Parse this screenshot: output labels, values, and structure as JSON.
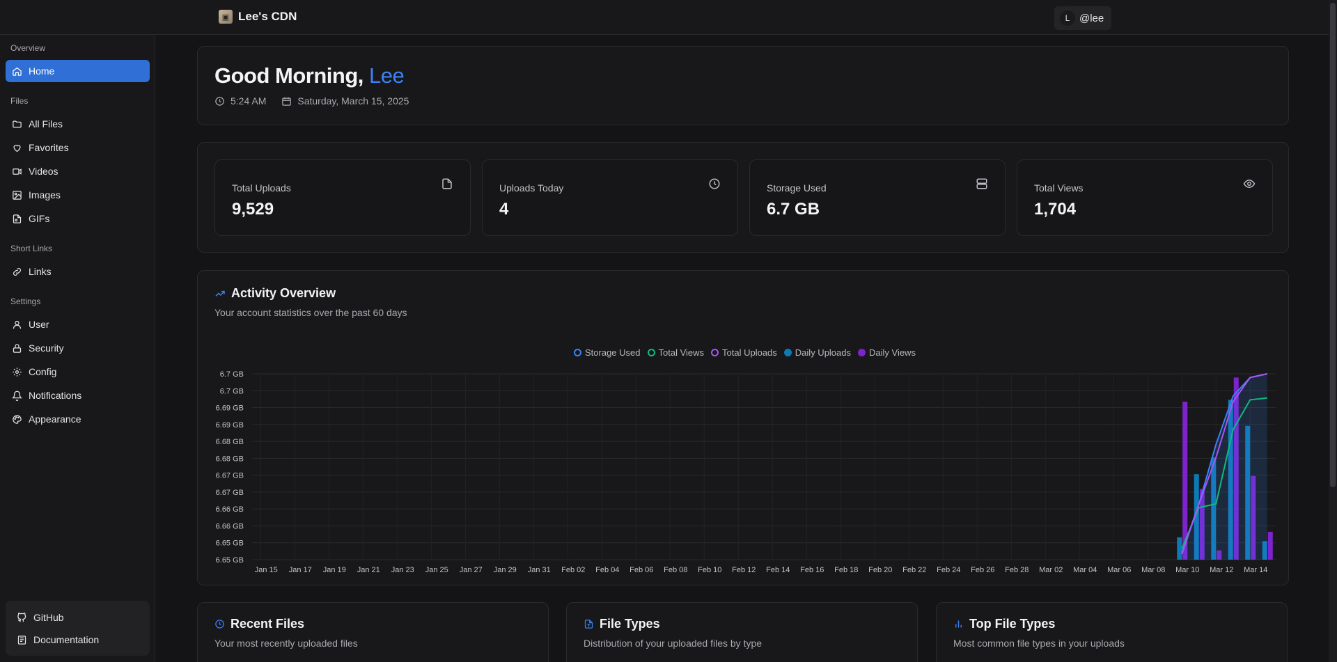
{
  "app": {
    "title": "Lee's CDN",
    "user_initial": "L",
    "username": "@lee"
  },
  "sidebar": {
    "sections": [
      {
        "title": "Overview",
        "items": [
          {
            "label": "Home",
            "icon": "home-icon",
            "active": true
          }
        ]
      },
      {
        "title": "Files",
        "items": [
          {
            "label": "All Files",
            "icon": "folder-icon"
          },
          {
            "label": "Favorites",
            "icon": "heart-icon"
          },
          {
            "label": "Videos",
            "icon": "video-icon"
          },
          {
            "label": "Images",
            "icon": "image-icon"
          },
          {
            "label": "GIFs",
            "icon": "file-gif-icon"
          }
        ]
      },
      {
        "title": "Short Links",
        "items": [
          {
            "label": "Links",
            "icon": "link-icon"
          }
        ]
      },
      {
        "title": "Settings",
        "items": [
          {
            "label": "User",
            "icon": "user-icon"
          },
          {
            "label": "Security",
            "icon": "lock-icon"
          },
          {
            "label": "Config",
            "icon": "gear-icon"
          },
          {
            "label": "Notifications",
            "icon": "bell-icon"
          },
          {
            "label": "Appearance",
            "icon": "palette-icon"
          }
        ]
      }
    ],
    "footer": [
      {
        "label": "GitHub",
        "icon": "github-icon"
      },
      {
        "label": "Documentation",
        "icon": "book-icon"
      }
    ]
  },
  "greeting": {
    "prefix": "Good Morning, ",
    "name": "Lee",
    "time": "5:24 AM",
    "date": "Saturday, March 15, 2025"
  },
  "stats": [
    {
      "label": "Total Uploads",
      "value": "9,529",
      "icon": "file-icon"
    },
    {
      "label": "Uploads Today",
      "value": "4",
      "icon": "clock-icon"
    },
    {
      "label": "Storage Used",
      "value": "6.7 GB",
      "icon": "server-icon"
    },
    {
      "label": "Total Views",
      "value": "1,704",
      "icon": "eye-icon"
    }
  ],
  "activity": {
    "title": "Activity Overview",
    "subtitle": "Your account statistics over the past 60 days"
  },
  "colors": {
    "accent": "#3b82f6",
    "storage": "#3b82f6",
    "views": "#10b981",
    "uploads": "#a855f7",
    "daily_uploads": "#0e7ab5",
    "daily_views": "#7e22ce"
  },
  "chart_data": {
    "type": "bar",
    "legend_position": "top",
    "grid": true,
    "series_legend": [
      {
        "name": "Storage Used",
        "style": "ring",
        "color": "#3b82f6"
      },
      {
        "name": "Total Views",
        "style": "ring",
        "color": "#10b981"
      },
      {
        "name": "Total Uploads",
        "style": "ring",
        "color": "#a855f7"
      },
      {
        "name": "Daily Uploads",
        "style": "fill",
        "color": "#0e7ab5"
      },
      {
        "name": "Daily Views",
        "style": "fill",
        "color": "#7e22ce"
      }
    ],
    "x_ticks": [
      "Jan 15",
      "Jan 17",
      "Jan 19",
      "Jan 21",
      "Jan 23",
      "Jan 25",
      "Jan 27",
      "Jan 29",
      "Jan 31",
      "Feb 02",
      "Feb 04",
      "Feb 06",
      "Feb 08",
      "Feb 10",
      "Feb 12",
      "Feb 14",
      "Feb 16",
      "Feb 18",
      "Feb 20",
      "Feb 22",
      "Feb 24",
      "Feb 26",
      "Feb 28",
      "Mar 02",
      "Mar 04",
      "Mar 06",
      "Mar 08",
      "Mar 10",
      "Mar 12",
      "Mar 14"
    ],
    "y_ticks": [
      "6.7 GB",
      "6.7 GB",
      "6.69 GB",
      "6.69 GB",
      "6.68 GB",
      "6.68 GB",
      "6.67 GB",
      "6.67 GB",
      "6.66 GB",
      "6.66 GB",
      "6.65 GB",
      "6.65 GB"
    ],
    "days": [
      "Mar 10",
      "Mar 11",
      "Mar 12",
      "Mar 13",
      "Mar 14",
      "Mar 15"
    ],
    "daily_uploads": [
      0.12,
      0.46,
      0.55,
      0.86,
      0.72,
      0.1
    ],
    "daily_views": [
      0.85,
      0.38,
      0.05,
      0.98,
      0.45,
      0.15
    ],
    "storage_used": [
      0.04,
      0.3,
      0.62,
      0.88,
      0.98,
      1.0
    ],
    "total_views": [
      0.06,
      0.28,
      0.3,
      0.7,
      0.86,
      0.87
    ],
    "total_uploads": [
      0.03,
      0.3,
      0.55,
      0.85,
      0.98,
      1.0
    ]
  },
  "bottom": [
    {
      "title": "Recent Files",
      "subtitle": "Your most recently uploaded files",
      "icon": "clock-icon"
    },
    {
      "title": "File Types",
      "subtitle": "Distribution of your uploaded files by type",
      "icon": "file-type-icon"
    },
    {
      "title": "Top File Types",
      "subtitle": "Most common file types in your uploads",
      "icon": "bar-chart-icon"
    }
  ]
}
